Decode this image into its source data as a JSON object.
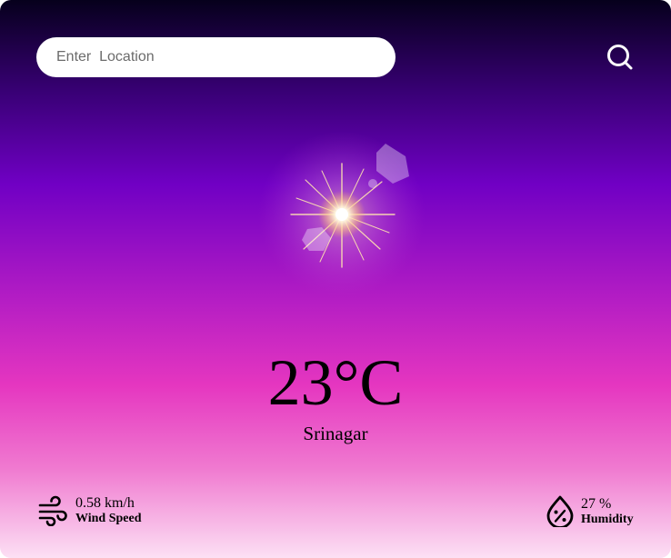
{
  "search": {
    "placeholder": "Enter  Location",
    "value": "",
    "button_icon": "search-icon"
  },
  "weather": {
    "icon": "sun-icon",
    "temperature": "23°C",
    "city": "Srinagar"
  },
  "metrics": {
    "wind": {
      "icon": "wind-icon",
      "value": "0.58 km/h",
      "label": "Wind Speed"
    },
    "humidity": {
      "icon": "humidity-icon",
      "value": "27 %",
      "label": "Humidity"
    }
  },
  "colors": {
    "gradient_top": "#06001c",
    "gradient_mid": "#7000c4",
    "gradient_pink": "#e536c0",
    "gradient_bottom": "#fce0f4",
    "search_bg": "#ffffff",
    "text": "#000000"
  }
}
